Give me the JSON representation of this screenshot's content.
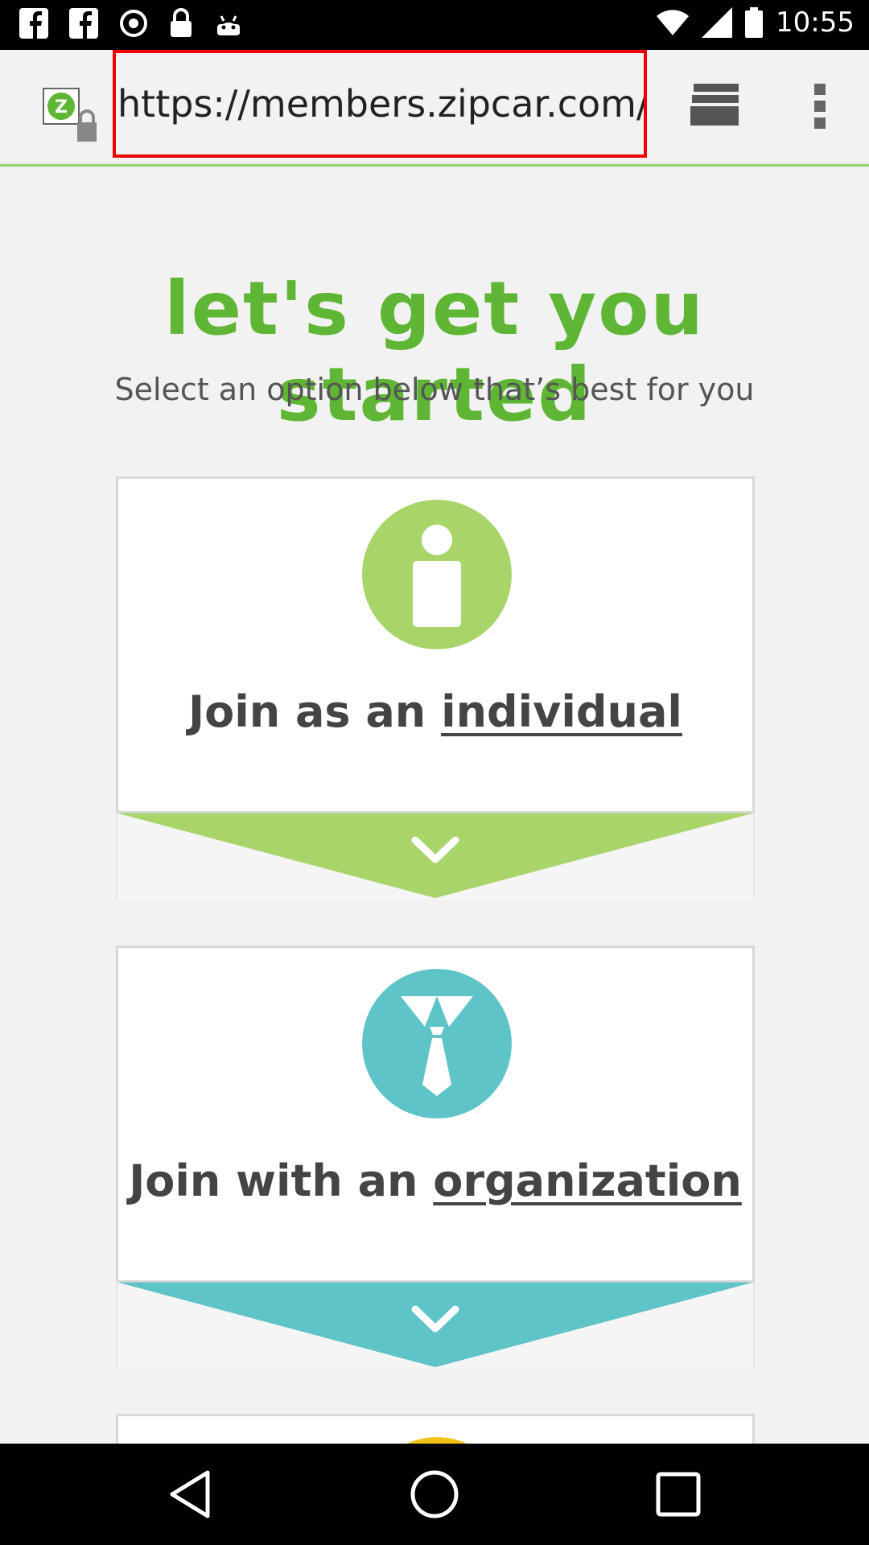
{
  "status_bar": {
    "time": "10:55"
  },
  "browser": {
    "url": "https://members.zipcar.com/reg",
    "site_icon_letter": "Z"
  },
  "page": {
    "headline": "let's get you started",
    "subhead": "Select an option below that’s best for you",
    "options": [
      {
        "prefix": "Join as an ",
        "link": "individual",
        "color": "#a8d46a"
      },
      {
        "prefix": "Join with an ",
        "link": "organization",
        "color": "#5fc4c7"
      }
    ],
    "third_option_accent": "#f2c314"
  },
  "colors": {
    "headline_green": "#5fb634",
    "individual_green": "#a8d46a",
    "organization_teal": "#5fc4c7",
    "url_highlight": "#e00000"
  }
}
